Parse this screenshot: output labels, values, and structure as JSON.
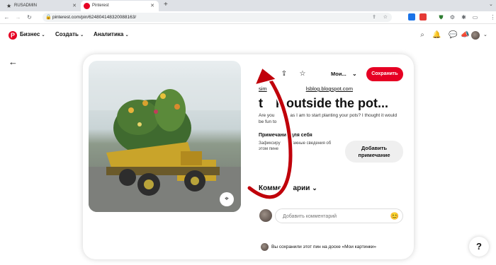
{
  "browser": {
    "tabs": [
      {
        "label": "RUSADMIN",
        "icon": "star-icon"
      },
      {
        "label": "Pinterest",
        "icon": "pinterest-icon"
      }
    ],
    "new_tab": "+",
    "url": "pinterest.com/pin/624804148320088163/"
  },
  "header": {
    "business_label": "Бизнес",
    "create_label": "Создать",
    "analytics_label": "Аналитика"
  },
  "pin": {
    "more_label": "•••",
    "board_label": "Мои...",
    "save_label": "Сохранить",
    "source_link": "simplylikeourselvesblog.blogspot.com",
    "source_link_visible": "sim",
    "source_link_visible_end": "lsblog.blogspot.com",
    "title": "think outside the pot...",
    "title_visible_a": "t",
    "title_visible_b": "k outside the pot...",
    "description": "Are you as  as I am to start planting your pots? I thought it would be fun to",
    "description_l1": "Are you",
    "description_l1b": "as I am to start planting your pots? I thought it would",
    "description_l2": "be fun to",
    "note_heading": "Примечание для себя",
    "note_text": "Зафиксируйте важные сведения об этом пине",
    "note_text_l1a": "Зафиксиру",
    "note_text_l1b": "важные сведения об",
    "note_text_l2a": "этом пине",
    "note_button_l1": "Добавить",
    "note_button_l2": "примечание",
    "comments_a": "Комме",
    "comments_b": "арии",
    "comment_placeholder": "Добавить комментарий",
    "saved_text": "Вы сохранили этот пин на доске «Мои картинки»",
    "help_label": "?"
  },
  "colors": {
    "brand": "#e60023",
    "arrow": "#c0000a"
  }
}
